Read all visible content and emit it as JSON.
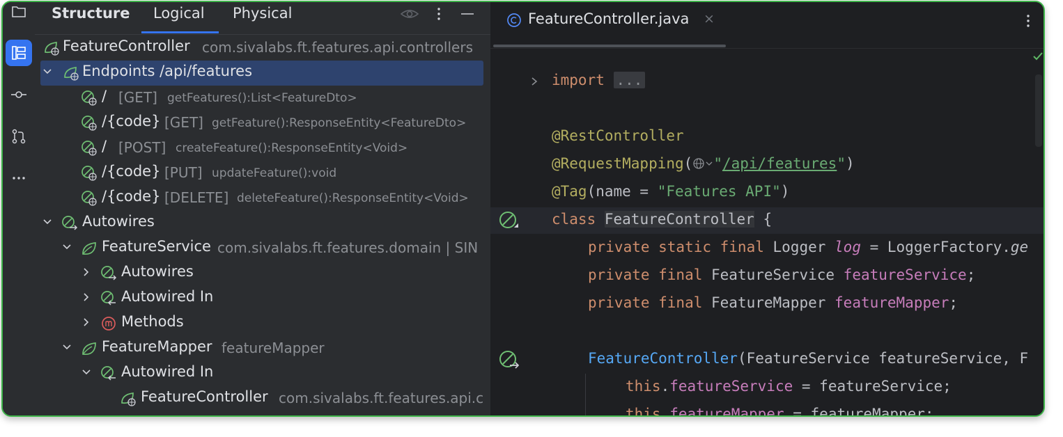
{
  "structure_panel": {
    "title": "Structure",
    "tabs": [
      {
        "label": "Logical",
        "active": true
      },
      {
        "label": "Physical",
        "active": false
      }
    ],
    "tree": {
      "root": {
        "label": "FeatureController",
        "detail": "com.sivalabs.ft.features.api.controllers"
      },
      "endpoints": {
        "label": "Endpoints /api/features"
      },
      "endpoint_items": [
        {
          "path": "/",
          "method": "[GET]",
          "signature": "getFeatures():List<FeatureDto>"
        },
        {
          "path": "/{code}",
          "method": "[GET]",
          "signature": "getFeature():ResponseEntity<FeatureDto>"
        },
        {
          "path": "/",
          "method": "[POST]",
          "signature": "createFeature():ResponseEntity<Void>"
        },
        {
          "path": "/{code}",
          "method": "[PUT]",
          "signature": "updateFeature():void"
        },
        {
          "path": "/{code}",
          "method": "[DELETE]",
          "signature": "deleteFeature():ResponseEntity<Void>"
        }
      ],
      "autowires": {
        "label": "Autowires"
      },
      "feature_service": {
        "label": "FeatureService",
        "detail": "com.sivalabs.ft.features.domain | SIN"
      },
      "fs_autowires": {
        "label": "Autowires"
      },
      "fs_autowired_in": {
        "label": "Autowired In"
      },
      "fs_methods": {
        "label": "Methods"
      },
      "feature_mapper": {
        "label": "FeatureMapper",
        "detail": "featureMapper"
      },
      "fm_autowired_in": {
        "label": "Autowired In"
      },
      "fm_controller": {
        "label": "FeatureController",
        "detail": "com.sivalabs.ft.features.api.c"
      }
    }
  },
  "editor": {
    "tab": {
      "filename": "FeatureController.java",
      "close": "×"
    },
    "code": {
      "l1": {
        "kw": "import",
        "fold": "..."
      },
      "l2": {
        "ann": "@RestController"
      },
      "l3": {
        "ann": "@RequestMapping",
        "open": "(",
        "str_open": "\"",
        "path": "/api/features",
        "str_close": "\"",
        "close": ")"
      },
      "l4": {
        "ann": "@Tag",
        "rest": "(name = ",
        "str": "\"Features API\"",
        "close": ")"
      },
      "l5": {
        "kw": "class",
        "name": "FeatureController",
        "rest": " {"
      },
      "l6": {
        "kw": "private static final",
        "type": " Logger ",
        "field": "log",
        "rest": " = LoggerFactory.",
        "tail": "ge"
      },
      "l7": {
        "kw": "private final",
        "type": " FeatureService ",
        "field": "featureService",
        "rest": ";"
      },
      "l8": {
        "kw": "private final",
        "type": " FeatureMapper ",
        "field": "featureMapper",
        "rest": ";"
      },
      "l9": {
        "fn": "FeatureController",
        "rest": "(FeatureService featureService, F"
      },
      "l10": {
        "kw": "this",
        "dot": ".",
        "field": "featureService",
        "rest": " = featureService;"
      },
      "l11": {
        "kw": "this",
        "dot": ".",
        "field": "featureMapper",
        "rest": " = featureMapper;"
      }
    }
  },
  "colors": {
    "accent": "#3574f0",
    "window_border": "#3fb54a",
    "spring_green": "#6fbf73",
    "selection": "#2e436e"
  },
  "icons": [
    "folder-icon",
    "structure-icon",
    "commit-icon",
    "pull-request-icon",
    "more-icon",
    "eye-icon",
    "kebab-icon",
    "minimize-icon",
    "spring-bean-icon",
    "endpoint-icon",
    "autowire-icon",
    "method-icon",
    "class-icon",
    "globe-icon",
    "check-icon"
  ]
}
